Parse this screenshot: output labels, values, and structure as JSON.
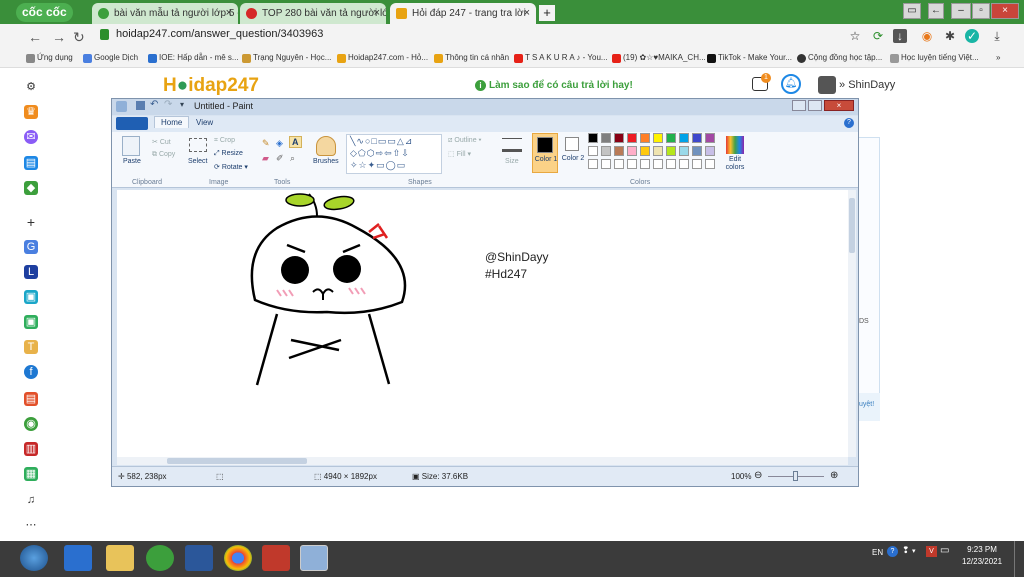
{
  "browser": {
    "brand": "cốc cốc",
    "tabs": [
      {
        "title": "bài văn mẫu tả người lớp 5 -",
        "active": false
      },
      {
        "title": "TOP 280 bài văn tả người lớp",
        "active": false
      },
      {
        "title": "Hỏi đáp 247 - trang tra lời",
        "active": true
      }
    ],
    "address": "hoidap247.com/answer_question/3403963",
    "bookmarks": [
      "Ứng dụng",
      "Google Dịch",
      "IOE: Hấp dẫn - mê s...",
      "Trạng Nguyên - Học...",
      "Hoidap247.com - Hỏ...",
      "Thông tin cá nhân",
      "T S A K U R A ♪ - You...",
      "(19) ✿☆♥MAIKA_CH...",
      "TikTok - Make Your...",
      "Cộng đồng học tập...",
      "Học luyện tiếng Việt..."
    ]
  },
  "site": {
    "logo_part1": "H",
    "logo_part2": "idap247",
    "tip": "Làm sao để có câu trả lời hay!",
    "notif_count": "1",
    "username": "ShinDayy",
    "side_text_1": "DS",
    "side_text_2": "uyệt!"
  },
  "paint": {
    "title": "Untitled - Paint",
    "ribbon_tabs": [
      "Home",
      "View"
    ],
    "clipboard": {
      "paste": "Paste",
      "cut": "Cut",
      "copy": "Copy",
      "group": "Clipboard"
    },
    "image": {
      "select": "Select",
      "crop": "Crop",
      "resize": "Resize",
      "rotate": "Rotate",
      "group": "Image"
    },
    "tools_group": "Tools",
    "brushes": "Brushes",
    "shapes": {
      "outline": "Outline",
      "fill": "Fill",
      "group": "Shapes"
    },
    "size": "Size",
    "color1": "Color 1",
    "color2": "Color 2",
    "edit_colors": "Edit colors",
    "colors_group": "Colors",
    "palette_row1": [
      "#000000",
      "#7f7f7f",
      "#880015",
      "#ed1c24",
      "#ff7f27",
      "#fff200",
      "#22b14c",
      "#00a2e8",
      "#3f48cc",
      "#a349a4"
    ],
    "palette_row2": [
      "#ffffff",
      "#c3c3c3",
      "#b97a57",
      "#ffaec9",
      "#ffc90e",
      "#efe4b0",
      "#b5e61d",
      "#99d9ea",
      "#7092be",
      "#c8bfe7"
    ],
    "canvas_text_1": "@ShinDayy",
    "canvas_text_2": "#Hd247",
    "status": {
      "cursor": "582, 238px",
      "dimensions": "4940 × 1892px",
      "size": "Size: 37.6KB",
      "zoom": "100%"
    }
  },
  "taskbar": {
    "lang": "EN",
    "time": "9:23 PM",
    "date": "12/23/2021"
  }
}
